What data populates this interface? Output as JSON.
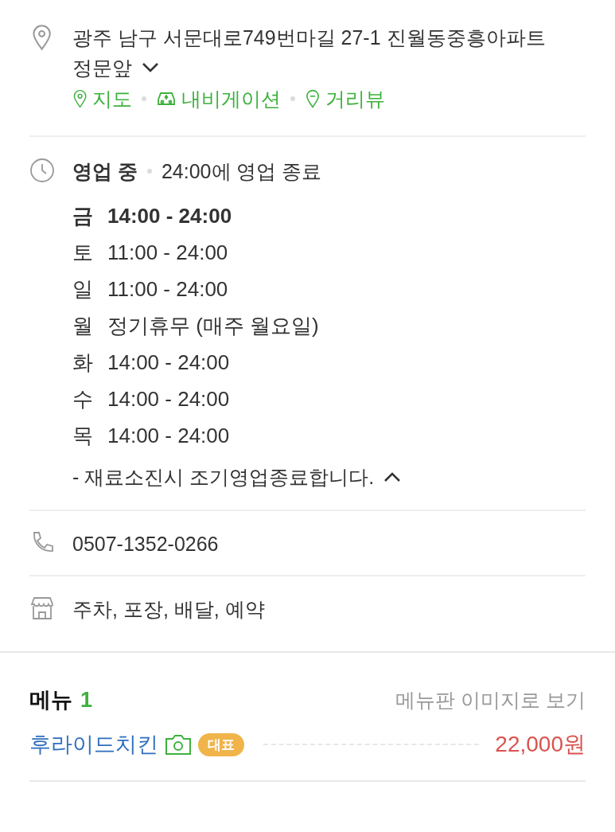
{
  "address": {
    "text": "광주 남구 서문대로749번마길 27-1 진월동중흥아파트",
    "line2": "정문앞",
    "expanded": false,
    "links": [
      {
        "kind": "map",
        "label": "지도"
      },
      {
        "kind": "navigation",
        "label": "내비게이션"
      },
      {
        "kind": "streetview",
        "label": "거리뷰"
      }
    ]
  },
  "hours": {
    "status": "영업 중",
    "closing": "24:00에 영업 종료",
    "expanded": true,
    "days": [
      {
        "day": "금",
        "time": "14:00 - 24:00",
        "today": true
      },
      {
        "day": "토",
        "time": "11:00 - 24:00",
        "today": false
      },
      {
        "day": "일",
        "time": "11:00 - 24:00",
        "today": false
      },
      {
        "day": "월",
        "time": "정기휴무 (매주 월요일)",
        "today": false
      },
      {
        "day": "화",
        "time": "14:00 - 24:00",
        "today": false
      },
      {
        "day": "수",
        "time": "14:00 - 24:00",
        "today": false
      },
      {
        "day": "목",
        "time": "14:00 - 24:00",
        "today": false
      }
    ],
    "note": "- 재료소진시 조기영업종료합니다."
  },
  "phone": "0507-1352-0266",
  "facilities": "주차, 포장, 배달, 예약",
  "menu": {
    "title": "메뉴",
    "count": "1",
    "image_link": "메뉴판 이미지로 보기",
    "items": [
      {
        "name": "후라이드치킨",
        "has_photo": true,
        "badge": "대표",
        "price": "22,000원"
      }
    ]
  }
}
